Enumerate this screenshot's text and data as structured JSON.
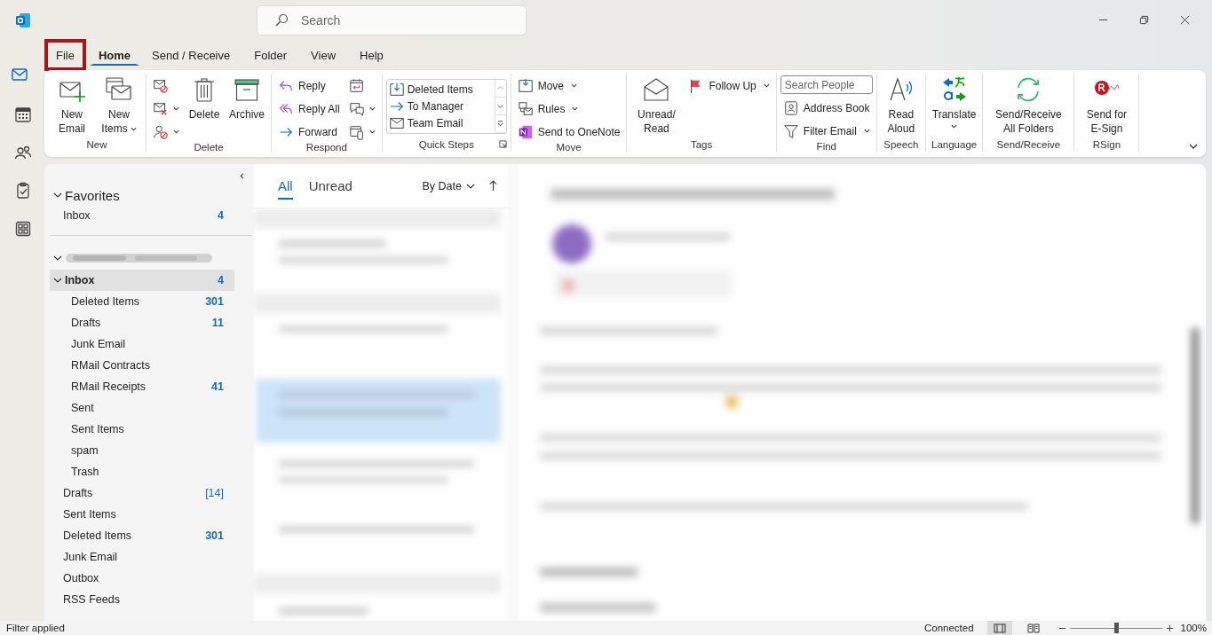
{
  "rail": [
    {
      "kind": "logo",
      "selected": false
    },
    {
      "kind": "mail",
      "selected": true
    },
    {
      "kind": "calendar",
      "selected": false
    },
    {
      "kind": "people",
      "selected": false
    },
    {
      "kind": "tasks",
      "selected": false
    },
    {
      "kind": "apps",
      "selected": false
    }
  ],
  "search": {
    "placeholder": "Search"
  },
  "menu_tabs": [
    {
      "label": "File",
      "selected": false,
      "highlighted": true
    },
    {
      "label": "Home",
      "selected": true,
      "highlighted": false
    },
    {
      "label": "Send / Receive",
      "selected": false,
      "highlighted": false
    },
    {
      "label": "Folder",
      "selected": false,
      "highlighted": false
    },
    {
      "label": "View",
      "selected": false,
      "highlighted": false
    },
    {
      "label": "Help",
      "selected": false,
      "highlighted": false
    }
  ],
  "ribbon": [
    {
      "label": "New",
      "controls": [
        {
          "kind": "large",
          "label": "New Email"
        },
        {
          "kind": "large",
          "label": "New Items",
          "dropdown": true
        }
      ]
    },
    {
      "label": "Delete",
      "controls": [
        {
          "kind": "stack",
          "items": [
            {
              "kind": "icon"
            },
            {
              "kind": "icon",
              "dropdown": true
            },
            {
              "kind": "icon",
              "dropdown": true
            }
          ]
        },
        {
          "kind": "large",
          "label": "Delete"
        },
        {
          "kind": "large",
          "label": "Archive"
        }
      ]
    },
    {
      "label": "Respond",
      "controls": [
        {
          "kind": "stack",
          "items": [
            {
              "kind": "small",
              "label": "Reply"
            },
            {
              "kind": "small",
              "label": "Reply All"
            },
            {
              "kind": "small",
              "label": "Forward"
            }
          ]
        },
        {
          "kind": "stack",
          "items": [
            {
              "kind": "icon"
            },
            {
              "kind": "icon",
              "dropdown": true
            },
            {
              "kind": "icon",
              "dropdown": true
            }
          ]
        }
      ]
    },
    {
      "label": "Quick Steps",
      "launcher": true,
      "controls": [
        {
          "kind": "gallery",
          "items": [
            {
              "label": "Deleted Items"
            },
            {
              "label": "To Manager"
            },
            {
              "label": "Team Email"
            }
          ]
        }
      ]
    },
    {
      "label": "Move",
      "controls": [
        {
          "kind": "stack",
          "items": [
            {
              "kind": "small",
              "label": "Move",
              "dropdown": true
            },
            {
              "kind": "small",
              "label": "Rules",
              "dropdown": true
            },
            {
              "kind": "small",
              "label": "Send to OneNote"
            }
          ]
        }
      ]
    },
    {
      "label": "Tags",
      "controls": [
        {
          "kind": "large",
          "label": "Unread/ Read"
        },
        {
          "kind": "stack",
          "items": [
            {
              "kind": "small",
              "label": "Follow Up",
              "dropdown": true
            }
          ]
        }
      ]
    },
    {
      "label": "Find",
      "controls": [
        {
          "kind": "stack",
          "items": [
            {
              "kind": "field",
              "placeholder": "Search People"
            },
            {
              "kind": "small",
              "label": "Address Book"
            },
            {
              "kind": "small",
              "label": "Filter Email",
              "dropdown": true
            }
          ]
        }
      ]
    },
    {
      "label": "Speech",
      "controls": [
        {
          "kind": "large",
          "label": "Read Aloud"
        }
      ]
    },
    {
      "label": "Language",
      "controls": [
        {
          "kind": "split",
          "label": "Translate",
          "dropdown": true
        }
      ]
    },
    {
      "label": "Send/Receive",
      "controls": [
        {
          "kind": "large",
          "label": "Send/Receive All Folders"
        }
      ]
    },
    {
      "label": "RSign",
      "controls": [
        {
          "kind": "large",
          "label": "Send for E-Sign"
        }
      ]
    }
  ],
  "favorites": {
    "label": "Favorites",
    "expanded": true,
    "folders": [
      {
        "name": "Inbox",
        "count": "4",
        "unread": true,
        "selected": false
      }
    ]
  },
  "account": {
    "expanded": true,
    "folders": [
      {
        "name": "Inbox",
        "count": "4",
        "unread": true,
        "selected": true,
        "expanded": true,
        "children": [
          {
            "name": "Deleted Items",
            "count": "301",
            "unread": true,
            "selected": false
          },
          {
            "name": "Drafts",
            "count": "11",
            "unread": true,
            "selected": false
          },
          {
            "name": "Junk Email",
            "selected": false
          },
          {
            "name": "RMail Contracts",
            "selected": false
          },
          {
            "name": "RMail Receipts",
            "count": "41",
            "unread": true,
            "selected": false
          },
          {
            "name": "Sent",
            "selected": false
          },
          {
            "name": "Sent Items",
            "selected": false
          },
          {
            "name": "spam",
            "selected": false
          },
          {
            "name": "Trash",
            "selected": false
          }
        ]
      },
      {
        "name": "Drafts",
        "count": "[14]",
        "unread": false,
        "selected": false
      },
      {
        "name": "Sent Items",
        "selected": false
      },
      {
        "name": "Deleted Items",
        "count": "301",
        "unread": true,
        "selected": false
      },
      {
        "name": "Junk Email",
        "selected": false
      },
      {
        "name": "Outbox",
        "selected": false
      },
      {
        "name": "RSS Feeds",
        "selected": false
      }
    ]
  },
  "message_list": {
    "filters": [
      {
        "label": "All",
        "selected": true
      },
      {
        "label": "Unread",
        "selected": false
      }
    ],
    "sort": "By Date"
  },
  "status_bar": {
    "left": "Filter applied",
    "connection": "Connected",
    "views": [
      {
        "kind": "normal",
        "selected": true
      },
      {
        "kind": "reading",
        "selected": false
      }
    ],
    "zoom": {
      "level": 0.5,
      "reading": "100%"
    }
  }
}
